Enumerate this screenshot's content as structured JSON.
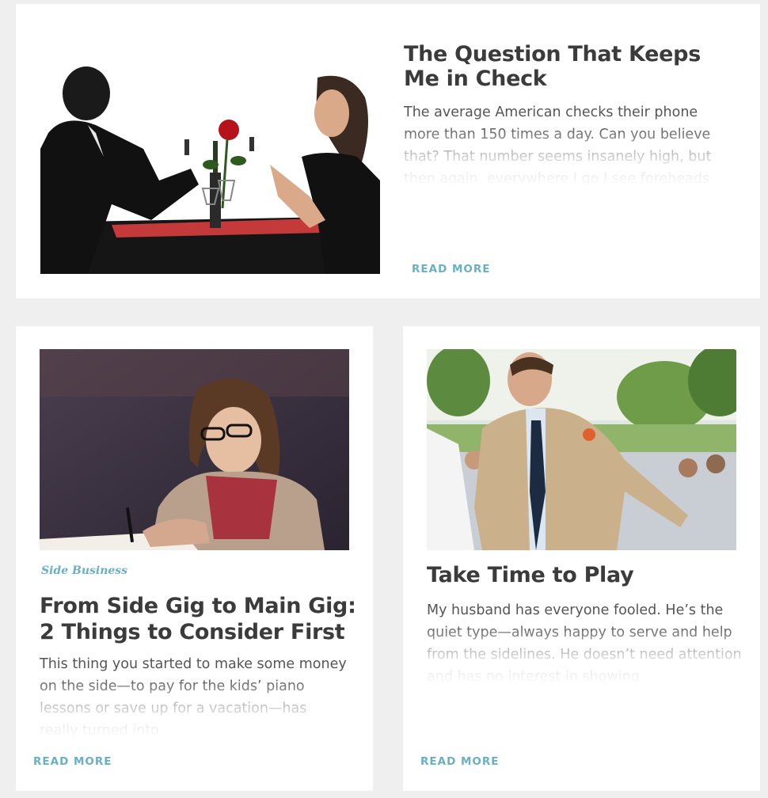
{
  "feature_article": {
    "title": "The Question That Keeps Me in Check",
    "excerpt": "The average American checks their phone more than 150 times a day. Can you believe that? That number seems insanely high, but then again, everywhere I go I see foreheads",
    "read_more_label": "READ MORE",
    "image_subject": "couple-on-phones-at-dinner-silhouette"
  },
  "articles": [
    {
      "category": "Side Business",
      "title": "From Side Gig to Main Gig: 2 Things to Consider First",
      "excerpt": "This thing you started to make some money on the side—to pay for the kids’ piano lessons or save up for a vacation—has really turned into",
      "read_more_label": "READ MORE",
      "image_subject": "woman-writing-at-desk"
    },
    {
      "title": "Take Time to Play",
      "excerpt": "My husband has everyone fooled. He’s the quiet type—always happy to serve and help from the sidelines. He doesn’t need attention and has no interest in showing",
      "read_more_label": "READ MORE",
      "image_subject": "groom-dancing-at-outdoor-wedding"
    }
  ],
  "colors": {
    "page_background": "#efefef",
    "card_background": "#ffffff",
    "title_text": "#3b3b3b",
    "body_text": "#555555",
    "accent_link": "#6ab0c4"
  }
}
